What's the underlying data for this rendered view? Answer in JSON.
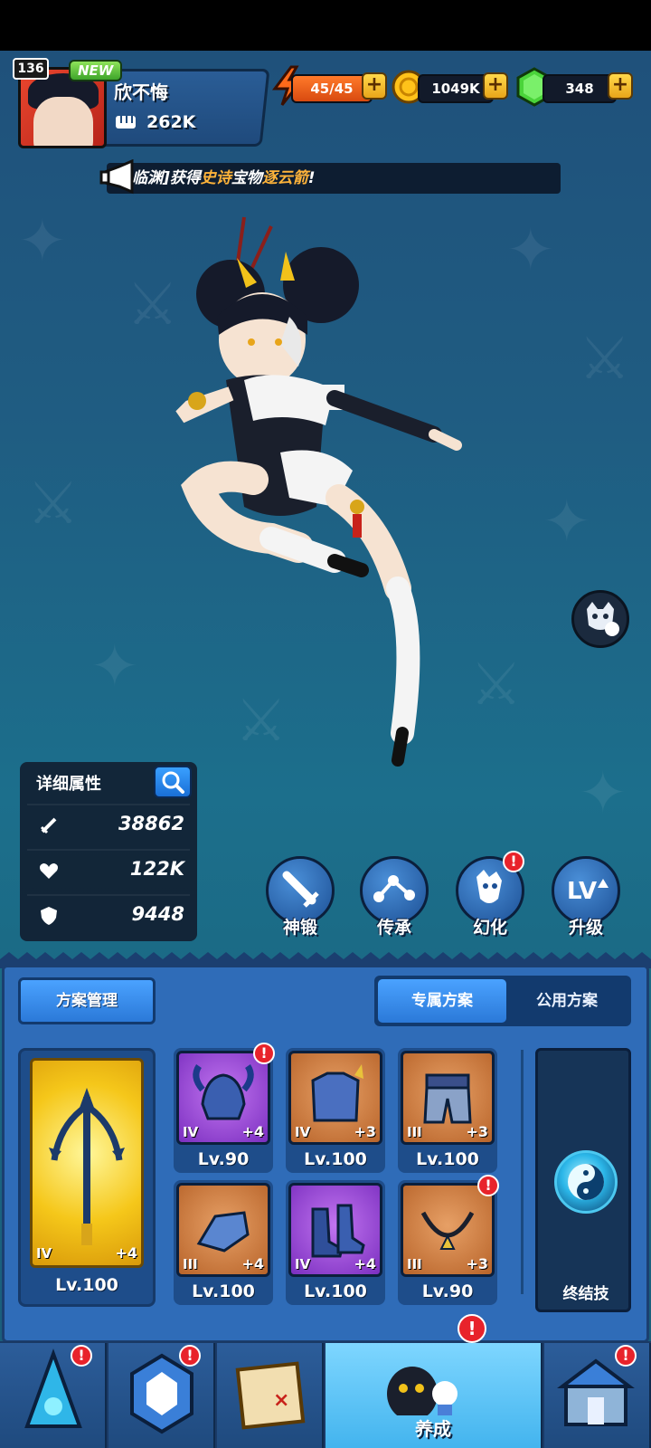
{
  "header": {
    "player_level": "136",
    "new_badge": "NEW",
    "player_name": "欣不悔",
    "power": "262K",
    "energy": "45/45",
    "gold": "1049K",
    "gems": "348",
    "plus_symbol": "+"
  },
  "announcement": {
    "prefix": "临渊]获得",
    "rarity": "史诗",
    "middle": "宝物",
    "item": "逐云箭",
    "suffix": "!"
  },
  "details": {
    "title": "详细属性",
    "attack": "38862",
    "hp": "122K",
    "defense": "9448"
  },
  "actions": [
    {
      "label": "神锻",
      "icon": "sword-icon"
    },
    {
      "label": "传承",
      "icon": "network-icon"
    },
    {
      "label": "幻化",
      "icon": "transform-icon"
    },
    {
      "label": "升级",
      "icon": "level-up-icon"
    }
  ],
  "equipment": {
    "plan_manage": "方案管理",
    "tab_exclusive": "专属方案",
    "tab_public": "公用方案",
    "weapon": {
      "tier": "IV",
      "plus": "+4",
      "level": "Lv.100"
    },
    "slots": [
      {
        "tier": "IV",
        "plus": "+4",
        "level": "Lv.90",
        "rarity": "purple",
        "icon": "helmet-icon"
      },
      {
        "tier": "IV",
        "plus": "+3",
        "level": "Lv.100",
        "rarity": "orange",
        "icon": "armor-icon"
      },
      {
        "tier": "III",
        "plus": "+3",
        "level": "Lv.100",
        "rarity": "orange",
        "icon": "pants-icon"
      },
      {
        "tier": "III",
        "plus": "+4",
        "level": "Lv.100",
        "rarity": "orange",
        "icon": "gauntlet-icon"
      },
      {
        "tier": "IV",
        "plus": "+4",
        "level": "Lv.100",
        "rarity": "purple",
        "icon": "boots-icon"
      },
      {
        "tier": "III",
        "plus": "+3",
        "level": "Lv.90",
        "rarity": "orange",
        "icon": "necklace-icon"
      }
    ],
    "ultimate_label": "终结技"
  },
  "nav": {
    "active_label": "养成"
  },
  "alert": "!"
}
